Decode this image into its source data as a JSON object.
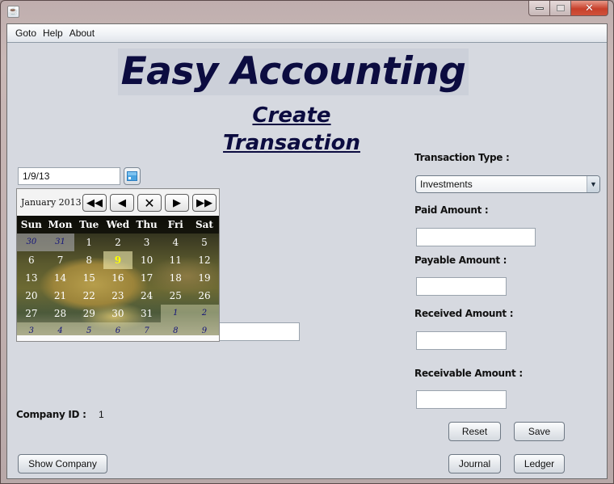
{
  "window": {
    "app_icon": "java-coffee-icon",
    "controls": {
      "minimize": "minimize-icon",
      "maximize": "maximize-icon",
      "close": "close-icon"
    }
  },
  "menubar": {
    "items": [
      {
        "label": "Goto"
      },
      {
        "label": "Help"
      },
      {
        "label": "About"
      }
    ]
  },
  "header": {
    "title": "Easy Accounting",
    "subtitle": "Create Transaction"
  },
  "date_picker": {
    "value": "1/9/13",
    "button_icon": "calendar-icon",
    "calendar": {
      "month_label": "January 2013",
      "nav": {
        "prev_year": "⏪",
        "prev_month": "◀",
        "clear": "✕",
        "next_month": "▶",
        "next_year": "⏩"
      },
      "weekdays": [
        "Sun",
        "Mon",
        "Tue",
        "Wed",
        "Thu",
        "Fri",
        "Sat"
      ],
      "weeks": [
        [
          "30",
          "31",
          "1",
          "2",
          "3",
          "4",
          "5"
        ],
        [
          "6",
          "7",
          "8",
          "9",
          "10",
          "11",
          "12"
        ],
        [
          "13",
          "14",
          "15",
          "16",
          "17",
          "18",
          "19"
        ],
        [
          "20",
          "21",
          "22",
          "23",
          "24",
          "25",
          "26"
        ],
        [
          "27",
          "28",
          "29",
          "30",
          "31",
          "1",
          "2"
        ],
        [
          "3",
          "4",
          "5",
          "6",
          "7",
          "8",
          "9"
        ]
      ],
      "selected_day": "9"
    }
  },
  "form": {
    "transaction_type_label": "Transaction Type :",
    "transaction_type_value": "Investments",
    "paid_amount_label": "Paid Amount :",
    "paid_amount_value": "",
    "payable_amount_label": "Payable Amount :",
    "payable_amount_value": "",
    "received_amount_label": "Received Amount :",
    "received_amount_value": "",
    "receivable_amount_label": "Receivable Amount :",
    "receivable_amount_value": "",
    "company_id_label": "Company ID :",
    "company_id_value": "1"
  },
  "buttons": {
    "reset": "Reset",
    "save": "Save",
    "journal": "Journal",
    "ledger": "Ledger",
    "show_company": "Show Company"
  },
  "colors": {
    "title_text": "#0c0c40",
    "client_background": "#d6d9e0",
    "close_button": "#c7402b",
    "selected_day": "#ffff00"
  }
}
